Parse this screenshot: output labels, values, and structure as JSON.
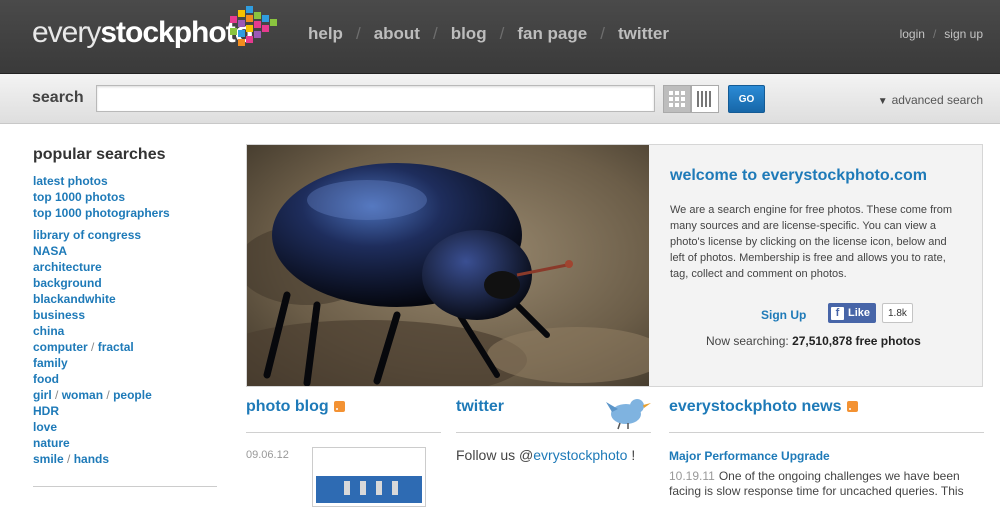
{
  "header": {
    "logo_light": "every",
    "logo_bold": "stockphoto",
    "nav": [
      "help",
      "about",
      "blog",
      "fan page",
      "twitter"
    ],
    "login": "login",
    "signup": "sign up"
  },
  "search": {
    "label": "search",
    "value": "",
    "placeholder": "",
    "go_label": "GO",
    "advanced": "advanced search"
  },
  "sidebar": {
    "title": "popular searches",
    "group1": [
      "latest photos",
      "top 1000 photos",
      "top 1000 photographers"
    ],
    "group2": [
      "library of congress",
      "NASA",
      "architecture",
      "background",
      "blackandwhite",
      "business",
      "china"
    ],
    "computer": "computer",
    "fractal": "fractal",
    "group3": [
      "family",
      "food"
    ],
    "girl": "girl",
    "woman": "woman",
    "people": "people",
    "group4": [
      "HDR",
      "love",
      "nature"
    ],
    "smile": "smile",
    "hands": "hands",
    "slash": "/"
  },
  "welcome": {
    "title": "welcome to everystockphoto.com",
    "text": "We are a search engine for free photos. These come from many sources and are license-specific. You can view a photo's license by clicking on the license icon, below and left of photos. Membership is free and allows you to rate, tag, collect and comment on photos.",
    "signup": "Sign Up",
    "fb_like": "Like",
    "fb_count": "1.8k",
    "now_searching_prefix": "Now searching:",
    "now_searching_count": "27,510,878 free photos"
  },
  "blog": {
    "title": "photo blog",
    "date": "09.06.12"
  },
  "twitter": {
    "title": "twitter",
    "follow_prefix": "Follow us",
    "handle_at": "@",
    "handle": "evrystockphoto",
    "suffix": "!"
  },
  "news": {
    "title": "everystockphoto news",
    "headline": "Major Performance Upgrade",
    "date": "10.19.11",
    "text": "One of the ongoing challenges we have been facing is slow response time for uncached queries. This"
  },
  "colors": {
    "link_blue": "#1e7ab8",
    "header_bg": "#3f3f3f",
    "go_button": "#1f78c2"
  }
}
